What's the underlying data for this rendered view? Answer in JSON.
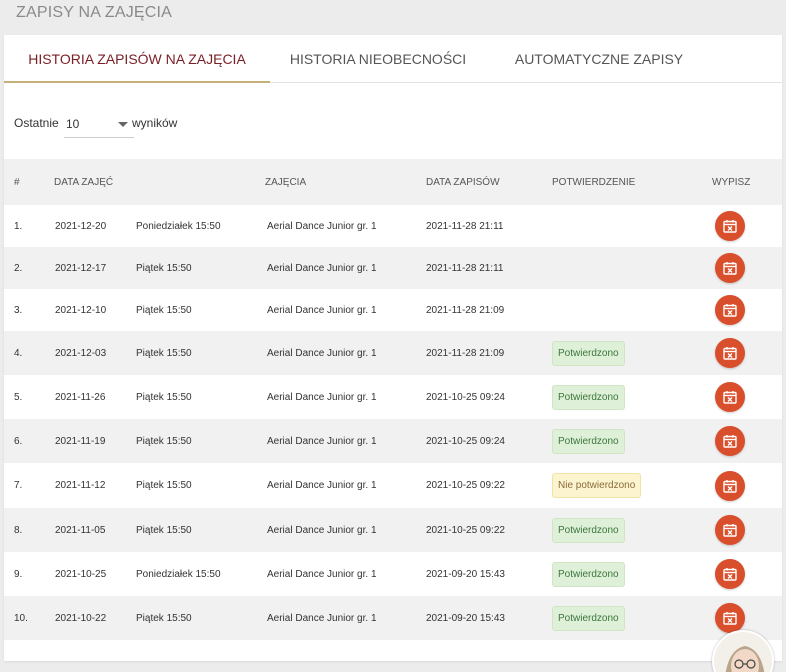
{
  "page": {
    "title": "ZAPISY NA ZAJĘCIA"
  },
  "tabs": [
    {
      "label": "HISTORIA ZAPISÓW NA ZAJĘCIA",
      "active": true
    },
    {
      "label": "HISTORIA NIEOBECNOŚCI",
      "active": false
    },
    {
      "label": "AUTOMATYCZNE ZAPISY",
      "active": false
    }
  ],
  "filter": {
    "label_before": "Ostatnie",
    "selected": "10",
    "label_after": "wyników"
  },
  "table": {
    "headers": [
      "#",
      "DATA ZAJĘĆ",
      "",
      "ZAJĘCIA",
      "DATA ZAPISÓW",
      "POTWIERDZENIE",
      "WYPISZ"
    ],
    "rows": [
      {
        "n": "1.",
        "date": "2021-12-20",
        "time": "Poniedziałek 15:50",
        "class": "Aerial Dance Junior gr. 1",
        "signup": "2021-11-28 21:11",
        "status": ""
      },
      {
        "n": "2.",
        "date": "2021-12-17",
        "time": "Piątek 15:50",
        "class": "Aerial Dance Junior gr. 1",
        "signup": "2021-11-28 21:11",
        "status": ""
      },
      {
        "n": "3.",
        "date": "2021-12-10",
        "time": "Piątek 15:50",
        "class": "Aerial Dance Junior gr. 1",
        "signup": "2021-11-28 21:09",
        "status": ""
      },
      {
        "n": "4.",
        "date": "2021-12-03",
        "time": "Piątek 15:50",
        "class": "Aerial Dance Junior gr. 1",
        "signup": "2021-11-28 21:09",
        "status": "Potwierdzono"
      },
      {
        "n": "5.",
        "date": "2021-11-26",
        "time": "Piątek 15:50",
        "class": "Aerial Dance Junior gr. 1",
        "signup": "2021-10-25 09:24",
        "status": "Potwierdzono"
      },
      {
        "n": "6.",
        "date": "2021-11-19",
        "time": "Piątek 15:50",
        "class": "Aerial Dance Junior gr. 1",
        "signup": "2021-10-25 09:24",
        "status": "Potwierdzono"
      },
      {
        "n": "7.",
        "date": "2021-11-12",
        "time": "Piątek 15:50",
        "class": "Aerial Dance Junior gr. 1",
        "signup": "2021-10-25 09:22",
        "status": "Nie potwierdzono"
      },
      {
        "n": "8.",
        "date": "2021-11-05",
        "time": "Piątek 15:50",
        "class": "Aerial Dance Junior gr. 1",
        "signup": "2021-10-25 09:22",
        "status": "Potwierdzono"
      },
      {
        "n": "9.",
        "date": "2021-10-25",
        "time": "Poniedziałek 15:50",
        "class": "Aerial Dance Junior gr. 1",
        "signup": "2021-09-20 15:43",
        "status": "Potwierdzono"
      },
      {
        "n": "10.",
        "date": "2021-10-22",
        "time": "Piątek 15:50",
        "class": "Aerial Dance Junior gr. 1",
        "signup": "2021-09-20 15:43",
        "status": "Potwierdzono"
      }
    ]
  },
  "icons": {
    "cancel": "calendar-x-icon",
    "avatar": "user-avatar"
  },
  "colors": {
    "accent": "#7a1f25",
    "underline": "#c5b07a",
    "cancel_button": "#d94e2b",
    "ok": "#dff0d8",
    "pending": "#fcf3cf"
  }
}
